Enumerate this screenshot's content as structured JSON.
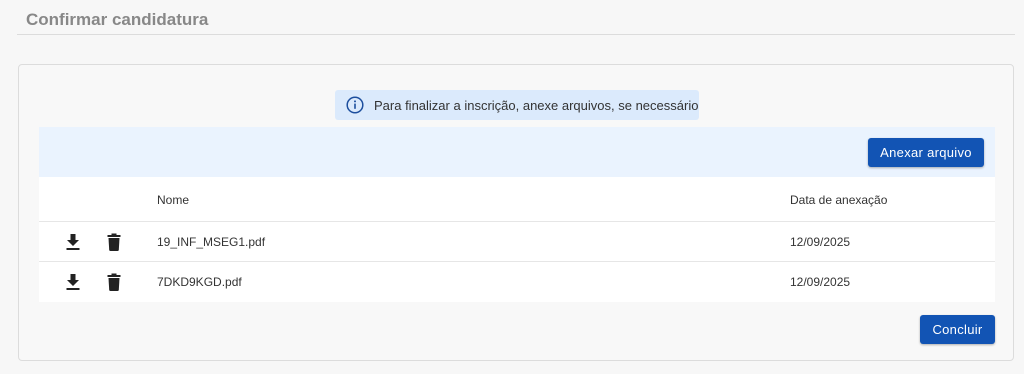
{
  "page": {
    "title": "Confirmar candidatura"
  },
  "banner": {
    "icon": "info-icon",
    "text": "Para finalizar a inscrição, anexe arquivos, se necessário"
  },
  "toolbar": {
    "attach_label": "Anexar arquivo"
  },
  "table": {
    "columns": {
      "name": "Nome",
      "date": "Data de anexação"
    },
    "rows": [
      {
        "name": "19_INF_MSEG1.pdf",
        "date": "12/09/2025"
      },
      {
        "name": "7DKD9KGD.pdf",
        "date": "12/09/2025"
      }
    ]
  },
  "actions": {
    "conclude_label": "Concluir"
  },
  "colors": {
    "accent": "#1254b4",
    "banner_bg": "#dbeafc",
    "toolbar_bg": "#eaf3fe",
    "info_icon": "#1d4f9e"
  }
}
